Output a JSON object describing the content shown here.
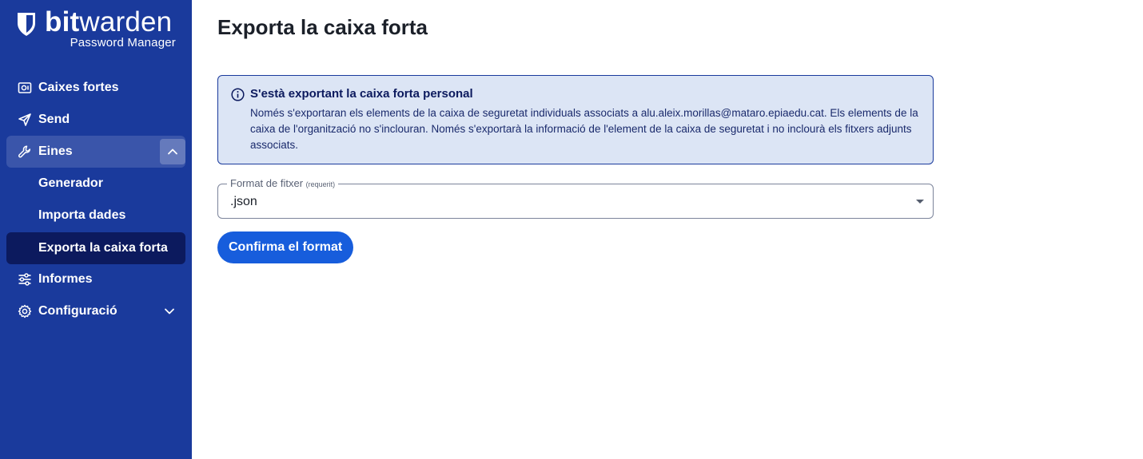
{
  "brand": {
    "name_bold": "bit",
    "name_regular": "warden",
    "subtitle": "Password Manager",
    "sidebar_color": "#1a3a9c",
    "accent": "#175ddc"
  },
  "sidebar": {
    "items": [
      {
        "label": "Caixes fortes",
        "icon": "vault-icon"
      },
      {
        "label": "Send",
        "icon": "send-icon"
      },
      {
        "label": "Eines",
        "icon": "wrench-icon",
        "expanded": true
      },
      {
        "label": "Generador",
        "sub": true
      },
      {
        "label": "Importa dades",
        "sub": true
      },
      {
        "label": "Exporta la caixa forta",
        "sub": true,
        "active": true
      },
      {
        "label": "Informes",
        "icon": "sliders-icon"
      },
      {
        "label": "Configuració",
        "icon": "gear-icon",
        "expanded": false
      }
    ]
  },
  "main": {
    "title": "Exporta la caixa forta",
    "callout": {
      "title": "S'està exportant la caixa forta personal",
      "text": "Només s'exportaran els elements de la caixa de seguretat individuals associats a alu.aleix.morillas@mataro.epiaedu.cat. Els elements de la caixa de l'organització no s'inclouran. Només s'exportarà la informació de l'element de la caixa de seguretat i no inclourà els fitxers adjunts associats."
    },
    "format_field": {
      "label": "Format de fitxer",
      "required": "(requerit)",
      "value": ".json"
    },
    "confirm_button": "Confirma el format"
  }
}
